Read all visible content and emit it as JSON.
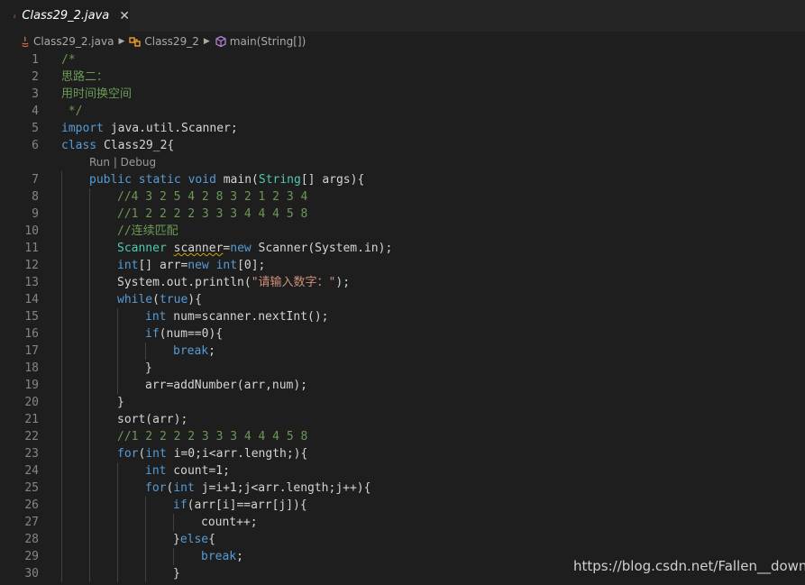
{
  "tab": {
    "label": "Class29_2.java",
    "close": "✕"
  },
  "breadcrumb": {
    "file": "Class29_2.java",
    "class": "Class29_2",
    "method": "main(String[])"
  },
  "codelens": "Run | Debug",
  "watermark": "https://blog.csdn.net/Fallen__down",
  "colors": {
    "background": "#1e1e1e",
    "comment": "#6a9955",
    "keyword": "#569cd6",
    "type": "#4ec9b0",
    "string": "#ce9178",
    "number": "#b5cea8",
    "line_number": "#858585"
  },
  "lines": [
    {
      "n": "1",
      "tokens": [
        [
          "/*",
          "comment"
        ]
      ]
    },
    {
      "n": "2",
      "tokens": [
        [
          "思路二：",
          "comment"
        ]
      ]
    },
    {
      "n": "3",
      "tokens": [
        [
          "用时间换空间",
          "comment"
        ]
      ]
    },
    {
      "n": "4",
      "tokens": [
        [
          " */",
          "comment"
        ]
      ]
    },
    {
      "n": "5",
      "tokens": [
        [
          "import",
          "kw"
        ],
        [
          " java.util.Scanner;",
          "plain"
        ]
      ]
    },
    {
      "n": "6",
      "tokens": [
        [
          "class",
          "kw"
        ],
        [
          " Class29_2{",
          "plain"
        ]
      ]
    },
    {
      "n": "7",
      "indent": 1,
      "tokens": [
        [
          "public",
          "kw"
        ],
        [
          " ",
          "plain"
        ],
        [
          "static",
          "kw"
        ],
        [
          " ",
          "plain"
        ],
        [
          "void",
          "kw"
        ],
        [
          " main(",
          "plain"
        ],
        [
          "String",
          "type"
        ],
        [
          "[] args){",
          "plain"
        ]
      ]
    },
    {
      "n": "8",
      "indent": 2,
      "tokens": [
        [
          "//4 3 2 5 4 2 8 3 2 1 2 3 4",
          "comment"
        ]
      ]
    },
    {
      "n": "9",
      "indent": 2,
      "tokens": [
        [
          "//1 2 2 2 2 3 3 3 4 4 4 5 8",
          "comment"
        ]
      ]
    },
    {
      "n": "10",
      "indent": 2,
      "tokens": [
        [
          "//连续匹配",
          "comment"
        ]
      ]
    },
    {
      "n": "11",
      "indent": 2,
      "tokens": [
        [
          "Scanner",
          "type"
        ],
        [
          " ",
          "plain"
        ],
        [
          "scanner",
          "warn"
        ],
        [
          "=",
          "plain"
        ],
        [
          "new",
          "kw"
        ],
        [
          " Scanner(System.in);",
          "plain"
        ]
      ]
    },
    {
      "n": "12",
      "indent": 2,
      "tokens": [
        [
          "int",
          "kw"
        ],
        [
          "[] arr=",
          "plain"
        ],
        [
          "new",
          "kw"
        ],
        [
          " ",
          "plain"
        ],
        [
          "int",
          "kw"
        ],
        [
          "[0];",
          "plain"
        ]
      ]
    },
    {
      "n": "13",
      "indent": 2,
      "tokens": [
        [
          "System.out.println(",
          "plain"
        ],
        [
          "\"请输入数字：\"",
          "str"
        ],
        [
          ");",
          "plain"
        ]
      ]
    },
    {
      "n": "14",
      "indent": 2,
      "tokens": [
        [
          "while",
          "kw"
        ],
        [
          "(",
          "plain"
        ],
        [
          "true",
          "kw"
        ],
        [
          "){",
          "plain"
        ]
      ]
    },
    {
      "n": "15",
      "indent": 3,
      "tokens": [
        [
          "int",
          "kw"
        ],
        [
          " num=scanner.nextInt();",
          "plain"
        ]
      ]
    },
    {
      "n": "16",
      "indent": 3,
      "tokens": [
        [
          "if",
          "kw"
        ],
        [
          "(num==0){",
          "plain"
        ]
      ]
    },
    {
      "n": "17",
      "indent": 4,
      "tokens": [
        [
          "break",
          "kw"
        ],
        [
          ";",
          "plain"
        ]
      ]
    },
    {
      "n": "18",
      "indent": 3,
      "tokens": [
        [
          "}",
          "plain"
        ]
      ]
    },
    {
      "n": "19",
      "indent": 3,
      "tokens": [
        [
          "arr=addNumber(arr,num);",
          "plain"
        ]
      ]
    },
    {
      "n": "20",
      "indent": 2,
      "tokens": [
        [
          "}",
          "plain"
        ]
      ]
    },
    {
      "n": "21",
      "indent": 2,
      "tokens": [
        [
          "sort(arr);",
          "plain"
        ]
      ]
    },
    {
      "n": "22",
      "indent": 2,
      "tokens": [
        [
          "//1 2 2 2 2 3 3 3 4 4 4 5 8",
          "comment"
        ]
      ]
    },
    {
      "n": "23",
      "indent": 2,
      "tokens": [
        [
          "for",
          "kw"
        ],
        [
          "(",
          "plain"
        ],
        [
          "int",
          "kw"
        ],
        [
          " i=0;i<arr.length;){",
          "plain"
        ]
      ]
    },
    {
      "n": "24",
      "indent": 3,
      "tokens": [
        [
          "int",
          "kw"
        ],
        [
          " count=1;",
          "plain"
        ]
      ]
    },
    {
      "n": "25",
      "indent": 3,
      "tokens": [
        [
          "for",
          "kw"
        ],
        [
          "(",
          "plain"
        ],
        [
          "int",
          "kw"
        ],
        [
          " j=i+1;j<arr.length;j++){",
          "plain"
        ]
      ]
    },
    {
      "n": "26",
      "indent": 4,
      "tokens": [
        [
          "if",
          "kw"
        ],
        [
          "(arr[i]==arr[j]){",
          "plain"
        ]
      ]
    },
    {
      "n": "27",
      "indent": 5,
      "tokens": [
        [
          "count++;",
          "plain"
        ]
      ]
    },
    {
      "n": "28",
      "indent": 4,
      "tokens": [
        [
          "}",
          "plain"
        ],
        [
          "else",
          "kw"
        ],
        [
          "{",
          "plain"
        ]
      ]
    },
    {
      "n": "29",
      "indent": 5,
      "tokens": [
        [
          "break",
          "kw"
        ],
        [
          ";",
          "plain"
        ]
      ]
    },
    {
      "n": "30",
      "indent": 4,
      "tokens": [
        [
          "}",
          "plain"
        ]
      ]
    }
  ]
}
